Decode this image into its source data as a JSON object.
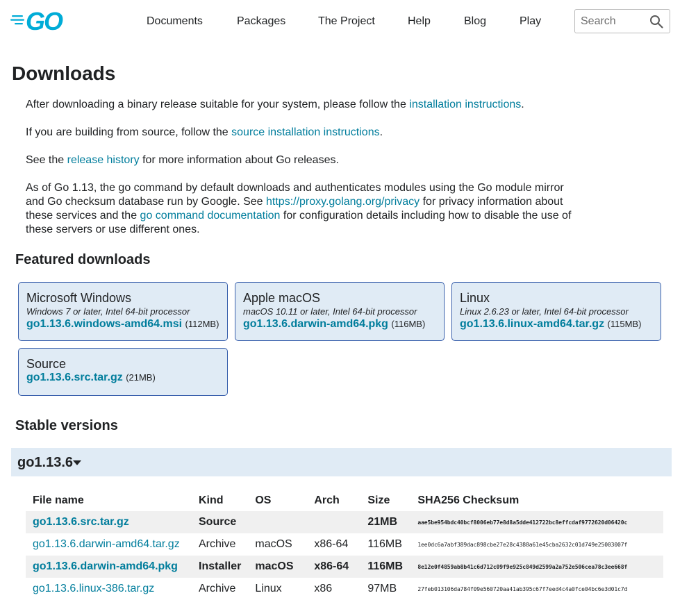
{
  "header": {
    "logo_text": "GO",
    "nav": [
      "Documents",
      "Packages",
      "The Project",
      "Help",
      "Blog",
      "Play"
    ],
    "search_placeholder": "Search",
    "colors": {
      "logo": "#00acd7",
      "text": "#202224",
      "link": "#007d9c"
    }
  },
  "page": {
    "title": "Downloads",
    "p1": {
      "before": "After downloading a binary release suitable for your system, please follow the ",
      "link": "installation instructions",
      "after": "."
    },
    "p2": {
      "before": "If you are building from source, follow the ",
      "link": "source installation instructions",
      "after": "."
    },
    "p3": {
      "before": "See the ",
      "link": "release history",
      "after": " for more information about Go releases."
    },
    "p4": {
      "before": "As of Go 1.13, the go command by default downloads and authenticates modules using the Go module mirror and Go checksum database run by Google. See ",
      "link1": "https://proxy.golang.org/privacy",
      "middle": " for privacy information about these services and the ",
      "link2": "go command documentation",
      "after": " for configuration details including how to disable the use of these servers or use different ones."
    }
  },
  "featured": {
    "title": "Featured downloads",
    "cards": [
      {
        "platform": "Microsoft Windows",
        "reqs": "Windows 7 or later, Intel 64-bit processor",
        "file": "go1.13.6.windows-amd64.msi",
        "size": "(112MB)"
      },
      {
        "platform": "Apple macOS",
        "reqs": "macOS 10.11 or later, Intel 64-bit processor",
        "file": "go1.13.6.darwin-amd64.pkg",
        "size": "(116MB)"
      },
      {
        "platform": "Linux",
        "reqs": "Linux 2.6.23 or later, Intel 64-bit processor",
        "file": "go1.13.6.linux-amd64.tar.gz",
        "size": "(115MB)"
      },
      {
        "platform": "Source",
        "reqs": "",
        "file": "go1.13.6.src.tar.gz",
        "size": "(21MB)"
      }
    ],
    "card_bg": "#e0ebf5",
    "card_border": "#375eab"
  },
  "stable": {
    "title": "Stable versions",
    "version": "go1.13.6",
    "table": {
      "headers": [
        "File name",
        "Kind",
        "OS",
        "Arch",
        "Size",
        "SHA256 Checksum"
      ],
      "rows": [
        {
          "file": "go1.13.6.src.tar.gz",
          "kind": "Source",
          "os": "",
          "arch": "",
          "size": "21MB",
          "checksum": "aae5be954bdc40bcf8006eb77e8d8a5dde412722bc8effcdaf9772620d06420c",
          "highlight": true
        },
        {
          "file": "go1.13.6.darwin-amd64.tar.gz",
          "kind": "Archive",
          "os": "macOS",
          "arch": "x86-64",
          "size": "116MB",
          "checksum": "1ee0dc6a7abf389dac898cbe27e28c4388a61e45cba2632c01d749e25003007f",
          "highlight": false
        },
        {
          "file": "go1.13.6.darwin-amd64.pkg",
          "kind": "Installer",
          "os": "macOS",
          "arch": "x86-64",
          "size": "116MB",
          "checksum": "8e12e0f4859ab8b41c6d712c09f9e925c849d2599a2a752e506cea78c3ee668f",
          "highlight": true
        },
        {
          "file": "go1.13.6.linux-386.tar.gz",
          "kind": "Archive",
          "os": "Linux",
          "arch": "x86",
          "size": "97MB",
          "checksum": "27feb013106da784f09e560720aa41ab395c67f7eed4c4a0fce04bc6e3d01c7d",
          "highlight": false
        }
      ]
    }
  }
}
